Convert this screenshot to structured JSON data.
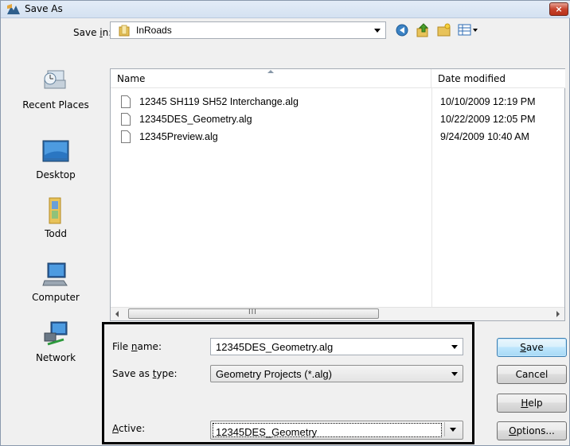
{
  "window": {
    "title": "Save As",
    "close_label": "×"
  },
  "savein": {
    "label_pre": "Save ",
    "label_key": "i",
    "label_post": "n:",
    "value": "InRoads"
  },
  "toolbar": {
    "icons": [
      "back-icon",
      "up-folder-icon",
      "new-folder-icon",
      "views-menu-icon"
    ]
  },
  "places": [
    {
      "label": "Recent Places",
      "icon": "recent-places-icon"
    },
    {
      "label": "Desktop",
      "icon": "desktop-icon"
    },
    {
      "label": "Todd",
      "icon": "user-folder-icon"
    },
    {
      "label": "Computer",
      "icon": "computer-icon"
    },
    {
      "label": "Network",
      "icon": "network-icon"
    }
  ],
  "filelist": {
    "columns": [
      "Name",
      "Date modified"
    ],
    "rows": [
      {
        "name": "12345 SH119 SH52 Interchange.alg",
        "date": "10/10/2009 12:19 PM"
      },
      {
        "name": "12345DES_Geometry.alg",
        "date": "10/22/2009 12:05 PM"
      },
      {
        "name": "12345Preview.alg",
        "date": "9/24/2009 10:40 AM"
      }
    ],
    "scroll_grip": "III"
  },
  "form": {
    "filename_label_pre": "File ",
    "filename_label_key": "n",
    "filename_label_post": "ame:",
    "filename_value": "12345DES_Geometry.alg",
    "type_label_pre": "Save as ",
    "type_label_key": "t",
    "type_label_post": "ype:",
    "type_value": "Geometry Projects (*.alg)",
    "active_label_key": "A",
    "active_label_post": "ctive:",
    "active_value": "12345DES_Geometry"
  },
  "buttons": {
    "save_key": "S",
    "save_post": "ave",
    "cancel": "Cancel",
    "help_key": "H",
    "help_post": "elp",
    "options_key": "O",
    "options_post": "ptions..."
  },
  "colors": {
    "accent": "#3c7fb1",
    "highlight_border": "#000000"
  }
}
